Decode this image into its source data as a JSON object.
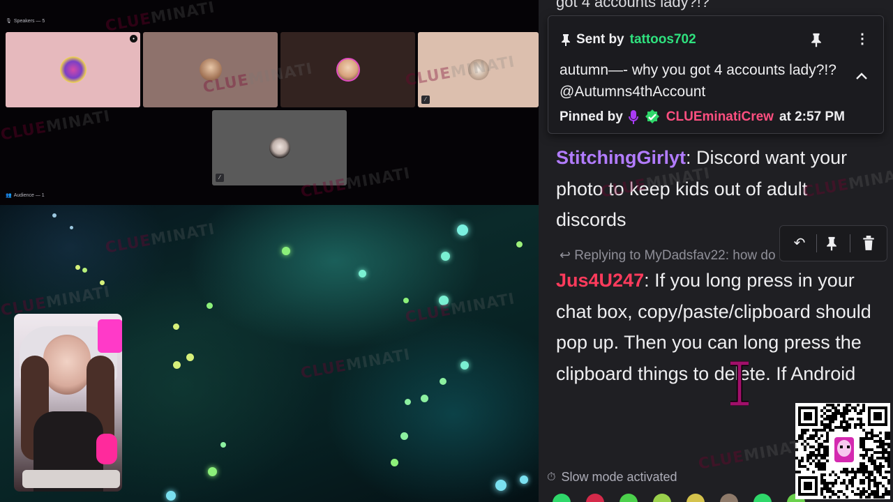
{
  "stage": {
    "speakers_label": "Speakers — 5",
    "audience_label": "Audience — 1",
    "watermark_a": "CLUE",
    "watermark_b": "MINATI",
    "tiles": [
      {
        "name": "speaker-tile-1",
        "bg": "#e6b9bd"
      },
      {
        "name": "speaker-tile-2",
        "bg": "#8e726c"
      },
      {
        "name": "speaker-tile-3",
        "bg": "#332320"
      },
      {
        "name": "speaker-tile-4",
        "bg": "#dcbfae"
      },
      {
        "name": "speaker-tile-5",
        "bg": "#5a5a5a"
      }
    ]
  },
  "chat": {
    "clipped_top_text": "got 4 accounts lady?!?",
    "pinned": {
      "sent_by_prefix": "Sent by",
      "sent_by_user": "tattoos702",
      "message": "autumn—- why you got 4 accounts lady?!? @Autumns4thAccount",
      "pinned_by_prefix": "Pinned by",
      "pinned_by_user": "CLUEminatiCrew",
      "pinned_at": "at 2:57 PM"
    },
    "messages": [
      {
        "user": "StitchingGirlyt",
        "text": "Discord want your photo to keep kids out of adult discords"
      },
      {
        "reply_to": "Replying to MyDadsfav22: how do",
        "user": "Jus4U247",
        "text": "If you long press in your chat box, copy/paste/clipboard should pop up. Then you can long press the clipboard things to delete. If Android"
      }
    ],
    "slow_mode": "Slow mode activated"
  },
  "colors": {
    "chat_bg": "#1f1f23",
    "green_user": "#2fe17e",
    "pink_user": "#ff4f80",
    "purple_user": "#b27cff",
    "red_user": "#ff3b5c"
  }
}
